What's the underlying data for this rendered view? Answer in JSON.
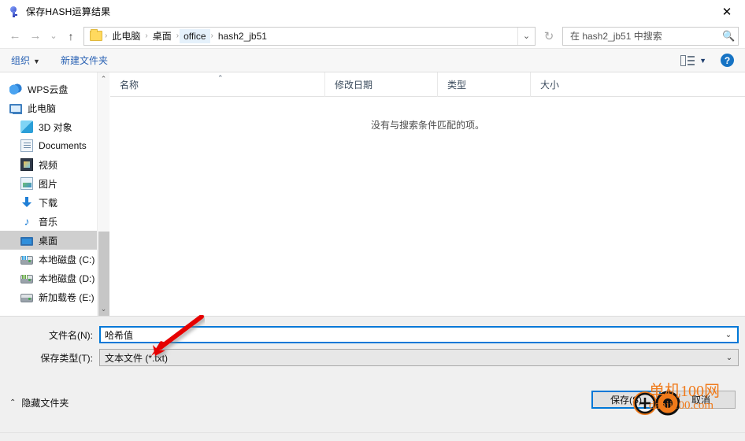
{
  "window": {
    "title": "保存HASH运算结果",
    "app_icon": "key-icon",
    "close_label": "✕"
  },
  "nav": {
    "back": "←",
    "forward": "→",
    "recent": "⌄",
    "up": "↑"
  },
  "address": {
    "folder_icon": "folder-icon",
    "separator": "›",
    "crumbs": [
      {
        "label": "此电脑",
        "highlighted": false
      },
      {
        "label": "桌面",
        "highlighted": false
      },
      {
        "label": "office",
        "highlighted": true
      },
      {
        "label": "hash2_jb51",
        "highlighted": false
      }
    ],
    "dropdown_caret": "⌄",
    "refresh_icon": "↻"
  },
  "search": {
    "placeholder": "在 hash2_jb51 中搜索",
    "icon": "search-icon"
  },
  "toolbar": {
    "organize_label": "组织",
    "organize_caret": "▼",
    "new_folder_label": "新建文件夹",
    "view_caret": "▼",
    "help_label": "?"
  },
  "sidebar": {
    "items": [
      {
        "label": "WPS云盘",
        "icon": "cloud-icon",
        "indent": false,
        "selected": false
      },
      {
        "label": "此电脑",
        "icon": "computer-icon",
        "indent": false,
        "selected": false
      },
      {
        "label": "3D 对象",
        "icon": "cube-icon",
        "indent": true,
        "selected": false
      },
      {
        "label": "Documents",
        "icon": "document-icon",
        "indent": true,
        "selected": false
      },
      {
        "label": "视频",
        "icon": "video-icon",
        "indent": true,
        "selected": false
      },
      {
        "label": "图片",
        "icon": "picture-icon",
        "indent": true,
        "selected": false
      },
      {
        "label": "下载",
        "icon": "download-icon",
        "indent": true,
        "selected": false
      },
      {
        "label": "音乐",
        "icon": "music-icon",
        "indent": true,
        "selected": false
      },
      {
        "label": "桌面",
        "icon": "desktop-icon",
        "indent": true,
        "selected": true
      },
      {
        "label": "本地磁盘 (C:)",
        "icon": "drive-c-icon",
        "indent": true,
        "selected": false
      },
      {
        "label": "本地磁盘 (D:)",
        "icon": "drive-d-icon",
        "indent": true,
        "selected": false
      },
      {
        "label": "新加载卷 (E:)",
        "icon": "drive-e-icon",
        "indent": true,
        "selected": false
      }
    ],
    "scroll_up": "⌃",
    "scroll_down": "⌄"
  },
  "filelist": {
    "columns": [
      {
        "label": "名称",
        "sorted": true,
        "sort_caret": "⌃"
      },
      {
        "label": "修改日期",
        "sorted": false
      },
      {
        "label": "类型",
        "sorted": false
      },
      {
        "label": "大小",
        "sorted": false
      }
    ],
    "rows": [],
    "empty_message": "没有与搜索条件匹配的项。"
  },
  "form": {
    "filename_label": "文件名(N):",
    "filename_value": "哈希值",
    "filename_caret": "⌄",
    "savetype_label": "保存类型(T):",
    "savetype_value": "文本文件 (*.txt)",
    "savetype_caret": "⌄"
  },
  "footer": {
    "hide_folders_caret": "⌃",
    "hide_folders_label": "隐藏文件夹",
    "save_label": "保存(S)",
    "cancel_label": "取消"
  },
  "watermark": {
    "line1": "单机100网",
    "line2": "danji100.com",
    "color": "#f07a1a"
  },
  "annotation": {
    "arrow_color": "#e60000"
  }
}
